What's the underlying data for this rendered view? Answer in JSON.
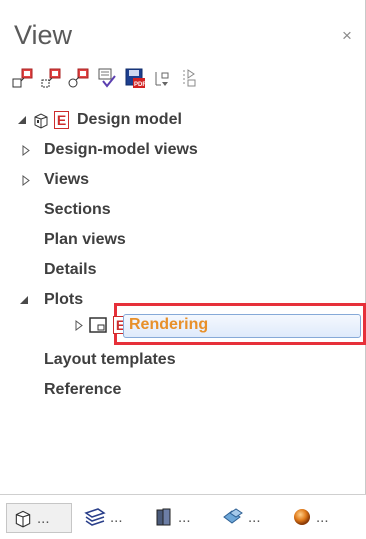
{
  "panel": {
    "title": "View",
    "close_glyph": "×"
  },
  "toolbar": {
    "items": [
      {
        "icon": "new-view-icon"
      },
      {
        "icon": "new-subview-icon"
      },
      {
        "icon": "duplicate-view-icon"
      },
      {
        "icon": "check-view-icon"
      },
      {
        "icon": "save-pdf-icon"
      },
      {
        "icon": "sort-icon"
      },
      {
        "icon": "move-icon"
      }
    ]
  },
  "tree": {
    "items": [
      {
        "label": "Design model"
      },
      {
        "label": "Design-model views"
      },
      {
        "label": "Views"
      },
      {
        "label": "Sections"
      },
      {
        "label": "Plan views"
      },
      {
        "label": "Details"
      },
      {
        "label": "Plots"
      },
      {
        "label": "Rendering"
      },
      {
        "label": "Layout templates"
      },
      {
        "label": "Reference"
      }
    ],
    "badge_letter": "E"
  },
  "bottom_tabs": [
    {
      "icon": "3d-model-icon",
      "dots": "..."
    },
    {
      "icon": "layers-icon",
      "dots": "..."
    },
    {
      "icon": "library-icon",
      "dots": "..."
    },
    {
      "icon": "objects-icon",
      "dots": "..."
    },
    {
      "icon": "materials-icon",
      "dots": "..."
    }
  ],
  "colors": {
    "highlight_border": "#e6303a",
    "selected_text": "#e8902a",
    "badge_red": "#cc2b2b"
  }
}
